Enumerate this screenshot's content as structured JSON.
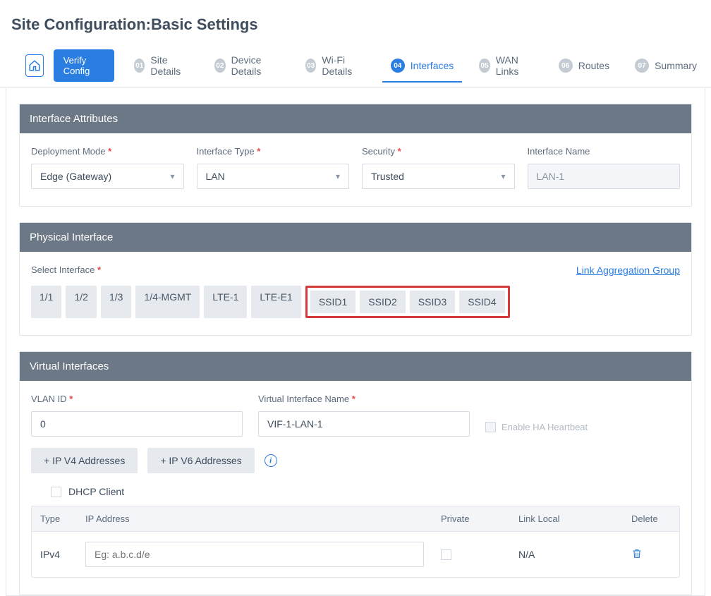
{
  "page_title": "Site Configuration:Basic Settings",
  "verify_label": "Verify Config",
  "steps": [
    {
      "num": "01",
      "label": "Site Details"
    },
    {
      "num": "02",
      "label": "Device Details"
    },
    {
      "num": "03",
      "label": "Wi-Fi Details"
    },
    {
      "num": "04",
      "label": "Interfaces"
    },
    {
      "num": "05",
      "label": "WAN Links"
    },
    {
      "num": "06",
      "label": "Routes"
    },
    {
      "num": "07",
      "label": "Summary"
    }
  ],
  "interface_attributes": {
    "header": "Interface Attributes",
    "deployment_mode": {
      "label": "Deployment Mode",
      "value": "Edge (Gateway)"
    },
    "interface_type": {
      "label": "Interface Type",
      "value": "LAN"
    },
    "security": {
      "label": "Security",
      "value": "Trusted"
    },
    "interface_name": {
      "label": "Interface Name",
      "value": "LAN-1"
    }
  },
  "physical_interface": {
    "header": "Physical Interface",
    "select_label": "Select Interface",
    "link_agg_label": "Link Aggregation Group",
    "chips_plain": [
      "1/1",
      "1/2",
      "1/3",
      "1/4-MGMT",
      "LTE-1",
      "LTE-E1"
    ],
    "chips_highlight": [
      "SSID1",
      "SSID2",
      "SSID3",
      "SSID4"
    ]
  },
  "virtual_interfaces": {
    "header": "Virtual Interfaces",
    "vlan_id": {
      "label": "VLAN ID",
      "value": "0"
    },
    "vi_name": {
      "label": "Virtual Interface Name",
      "value": "VIF-1-LAN-1"
    },
    "enable_ha_label": "Enable HA Heartbeat",
    "ipv4_btn": "+ IP V4 Addresses",
    "ipv6_btn": "+ IP V6 Addresses",
    "dhcp_label": "DHCP Client",
    "table": {
      "headers": {
        "type": "Type",
        "ip": "IP Address",
        "priv": "Private",
        "link": "Link Local",
        "del": "Delete"
      },
      "row": {
        "type": "IPv4",
        "placeholder": "Eg: a.b.c.d/e",
        "link_local": "N/A"
      }
    }
  }
}
